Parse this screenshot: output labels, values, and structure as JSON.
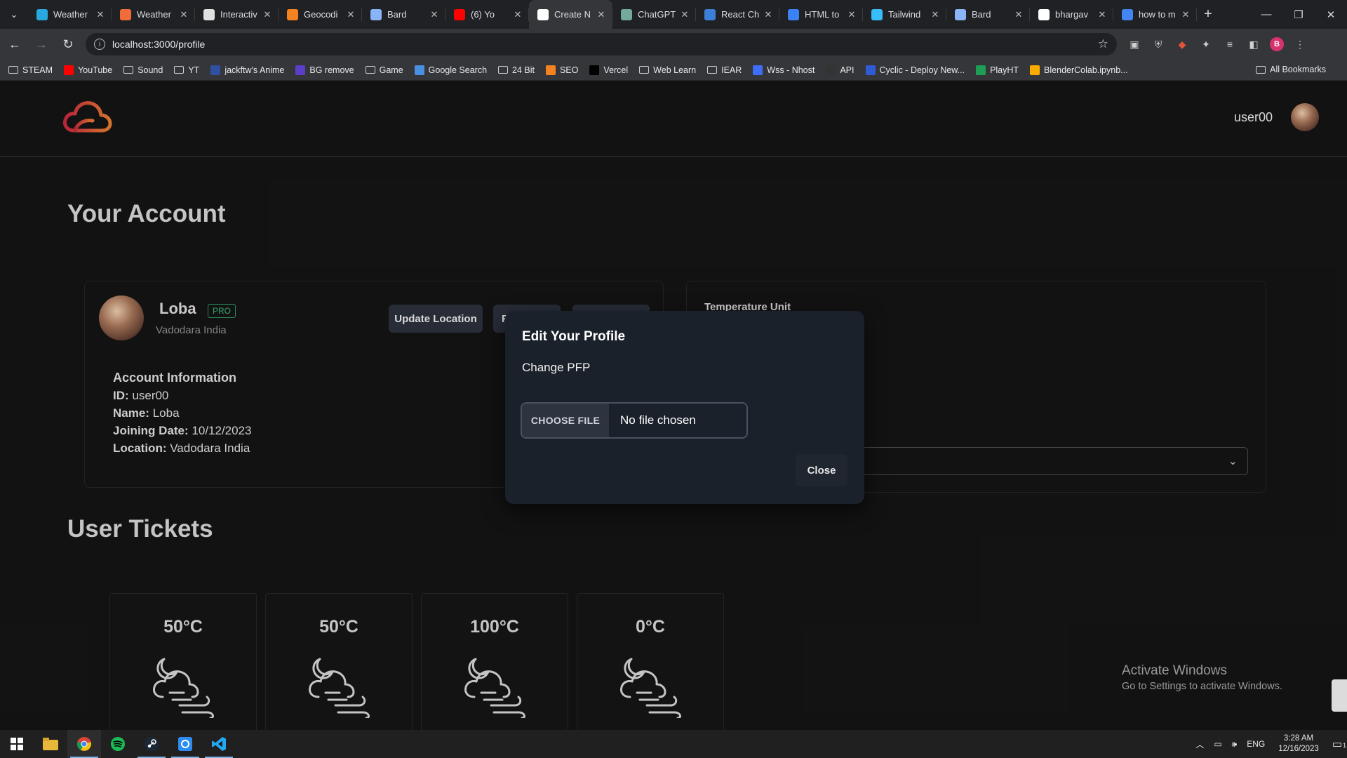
{
  "browser": {
    "tabs": [
      {
        "label": "Weather",
        "favicon": "weather-icon",
        "color": "#29a8e0"
      },
      {
        "label": "Weather",
        "favicon": "weather-icon",
        "color": "#f26b3a"
      },
      {
        "label": "Interactiv",
        "favicon": "page-icon",
        "color": "#e0e0e0"
      },
      {
        "label": "Geocodi",
        "favicon": "om-icon",
        "color": "#f58220"
      },
      {
        "label": "Bard",
        "favicon": "bard-icon",
        "color": "#8ab4f8"
      },
      {
        "label": "(6) Yo",
        "favicon": "youtube-icon",
        "color": "#ff0000"
      },
      {
        "label": "Create N",
        "favicon": "vercel-icon",
        "color": "#ffffff"
      },
      {
        "label": "ChatGPT",
        "favicon": "chatgpt-icon",
        "color": "#74aa9c"
      },
      {
        "label": "React Ch",
        "favicon": "react-chart-icon",
        "color": "#3d7fd6"
      },
      {
        "label": "HTML to",
        "favicon": "html-icon",
        "color": "#3b82f6"
      },
      {
        "label": "Tailwind",
        "favicon": "tailwind-icon",
        "color": "#38bdf8"
      },
      {
        "label": "Bard",
        "favicon": "bard-icon",
        "color": "#8ab4f8"
      },
      {
        "label": "bhargav",
        "favicon": "github-icon",
        "color": "#ffffff"
      },
      {
        "label": "how to m",
        "favicon": "google-icon",
        "color": "#4285f4"
      }
    ],
    "url": "localhost:3000/profile",
    "profile_initial": "B",
    "bookmarks": [
      {
        "label": "STEAM",
        "icon": "folder"
      },
      {
        "label": "YouTube",
        "icon": "youtube-icon"
      },
      {
        "label": "Sound",
        "icon": "folder"
      },
      {
        "label": "YT",
        "icon": "folder"
      },
      {
        "label": "jackftw's Anime",
        "icon": "mal-icon"
      },
      {
        "label": "BG remove",
        "icon": "bg-remove-icon"
      },
      {
        "label": "Game",
        "icon": "folder"
      },
      {
        "label": "Google Search",
        "icon": "google-search-icon"
      },
      {
        "label": "24 Bit",
        "icon": "folder"
      },
      {
        "label": "SEO",
        "icon": "seo-icon"
      },
      {
        "label": "Vercel",
        "icon": "vercel-icon"
      },
      {
        "label": "Web Learn",
        "icon": "folder"
      },
      {
        "label": "IEAR",
        "icon": "folder"
      },
      {
        "label": "Wss - Nhost",
        "icon": "nhost-icon"
      },
      {
        "label": "API",
        "icon": "github-icon"
      },
      {
        "label": "Cyclic - Deploy New...",
        "icon": "cyclic-icon"
      },
      {
        "label": "PlayHT",
        "icon": "playht-icon"
      },
      {
        "label": "BlenderColab.ipynb...",
        "icon": "colab-icon"
      }
    ],
    "all_bookmarks": "All Bookmarks"
  },
  "header": {
    "username": "user00"
  },
  "account": {
    "title": "Your Account",
    "profile_name": "Loba",
    "badge": "PRO",
    "location": "Vadodara India",
    "buttons": {
      "update_location": "Update Location",
      "edit_profile_partial": "F"
    },
    "info": {
      "title": "Account Information",
      "id_label": "ID:",
      "id_value": "user00",
      "name_label": "Name:",
      "name_value": "Loba",
      "joining_label": "Joining Date:",
      "joining_value": "10/12/2023",
      "location_label": "Location:",
      "location_value": "Vadodara India"
    }
  },
  "settings": {
    "temperature_label": "Temperature Unit"
  },
  "tickets": {
    "title": "User Tickets",
    "items": [
      {
        "temp": "50°C"
      },
      {
        "temp": "50°C"
      },
      {
        "temp": "100°C"
      },
      {
        "temp": "0°C"
      }
    ]
  },
  "modal": {
    "title": "Edit Your Profile",
    "subtitle": "Change PFP",
    "file_button": "CHOOSE FILE",
    "file_status": "No file chosen",
    "close_label": "Close"
  },
  "watermark": {
    "line1": "Activate Windows",
    "line2": "Go to Settings to activate Windows."
  },
  "taskbar": {
    "language": "ENG",
    "time": "3:28 AM",
    "date": "12/16/2023",
    "notification_count": "1"
  },
  "colors": {
    "logo_gradient_start": "#c0263d",
    "logo_gradient_end": "#e07a2f",
    "pro_badge": "#3ab06f"
  }
}
